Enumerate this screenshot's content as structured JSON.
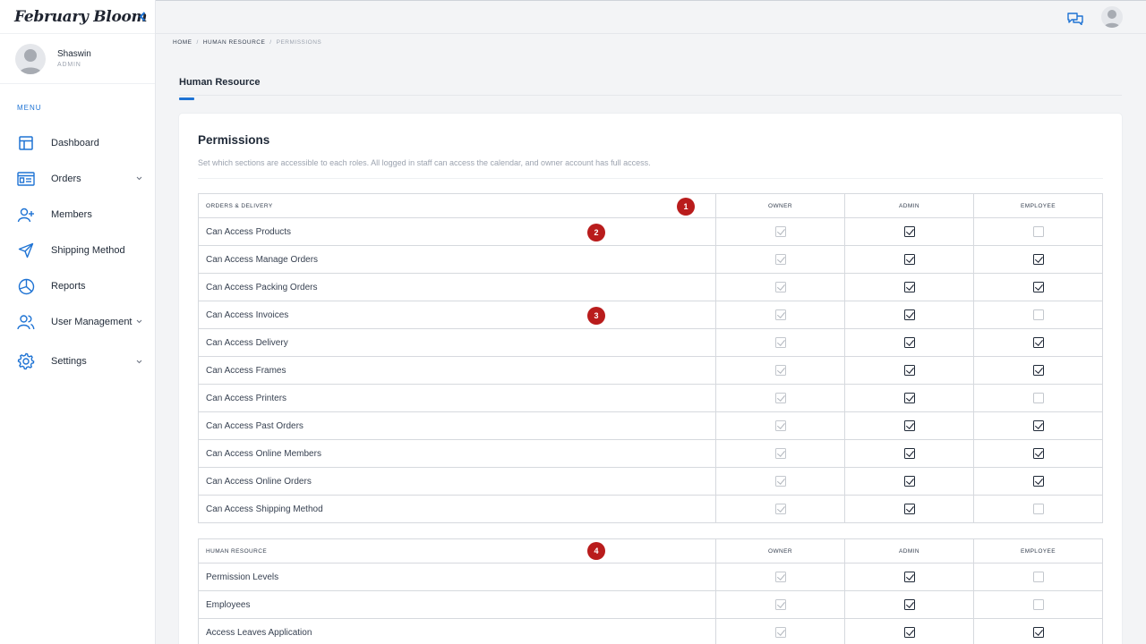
{
  "app": {
    "brand": "February Bloom"
  },
  "user": {
    "name": "Shaswin",
    "role": "ADMIN"
  },
  "sidebar": {
    "menu_label": "MENU",
    "items": [
      {
        "label": "Dashboard",
        "icon": "dashboard-icon",
        "has_chevron": false
      },
      {
        "label": "Orders",
        "icon": "orders-icon",
        "has_chevron": true
      },
      {
        "label": "Members",
        "icon": "add-user-icon",
        "has_chevron": false
      },
      {
        "label": "Shipping Method",
        "icon": "send-icon",
        "has_chevron": false
      },
      {
        "label": "Reports",
        "icon": "pie-chart-icon",
        "has_chevron": false
      },
      {
        "label": "User Management",
        "icon": "users-icon",
        "has_chevron": true
      },
      {
        "label": "Settings",
        "icon": "gear-icon",
        "has_chevron": true
      }
    ]
  },
  "breadcrumb": {
    "home": "HOME",
    "section": "HUMAN RESOURCE",
    "current": "PERMISSIONS"
  },
  "page": {
    "tab": "Human Resource"
  },
  "card": {
    "title": "Permissions",
    "subtitle": "Set which sections are accessible to each roles. All logged in staff can access the calendar, and owner account has full access."
  },
  "roles": [
    "OWNER",
    "ADMIN",
    "EMPLOYEE"
  ],
  "sections": [
    {
      "title": "ORDERS & DELIVERY",
      "rows": [
        {
          "name": "Can Access Products",
          "owner": true,
          "admin": true,
          "employee": false
        },
        {
          "name": "Can Access Manage Orders",
          "owner": true,
          "admin": true,
          "employee": true
        },
        {
          "name": "Can Access Packing Orders",
          "owner": true,
          "admin": true,
          "employee": true
        },
        {
          "name": "Can Access Invoices",
          "owner": true,
          "admin": true,
          "employee": false
        },
        {
          "name": "Can Access Delivery",
          "owner": true,
          "admin": true,
          "employee": true
        },
        {
          "name": "Can Access Frames",
          "owner": true,
          "admin": true,
          "employee": true
        },
        {
          "name": "Can Access Printers",
          "owner": true,
          "admin": true,
          "employee": false
        },
        {
          "name": "Can Access Past Orders",
          "owner": true,
          "admin": true,
          "employee": true
        },
        {
          "name": "Can Access Online Members",
          "owner": true,
          "admin": true,
          "employee": true
        },
        {
          "name": "Can Access Online Orders",
          "owner": true,
          "admin": true,
          "employee": true
        },
        {
          "name": "Can Access Shipping Method",
          "owner": true,
          "admin": true,
          "employee": false
        }
      ]
    },
    {
      "title": "HUMAN RESOURCE",
      "rows": [
        {
          "name": "Permission Levels",
          "owner": true,
          "admin": true,
          "employee": false
        },
        {
          "name": "Employees",
          "owner": true,
          "admin": true,
          "employee": false
        },
        {
          "name": "Access Leaves Application",
          "owner": true,
          "admin": true,
          "employee": true
        }
      ]
    }
  ],
  "markers": [
    "1",
    "2",
    "3",
    "4"
  ],
  "colors": {
    "accent": "#1e73d4",
    "marker": "#b91c1c"
  }
}
